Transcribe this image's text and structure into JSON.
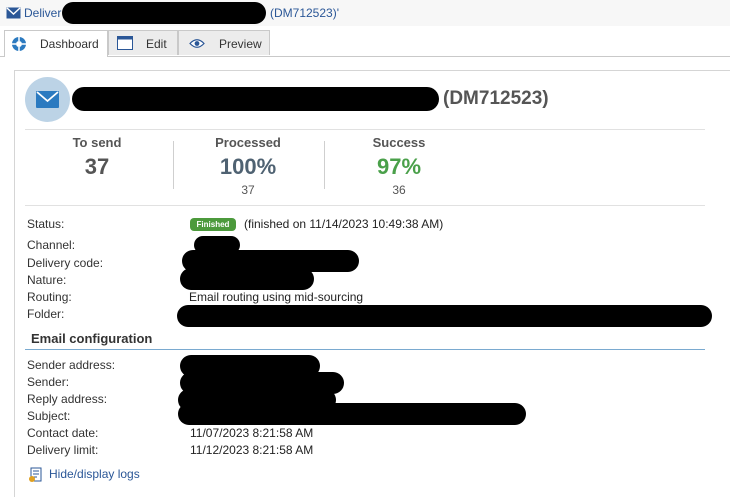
{
  "titlebar": {
    "prefix": "Deliver",
    "suffix": "(DM712523)'"
  },
  "tabs": [
    {
      "label": "Dashboard",
      "active": true
    },
    {
      "label": "Edit",
      "active": false
    },
    {
      "label": "Preview",
      "active": false
    }
  ],
  "header": {
    "code": "(DM712523)"
  },
  "stats": {
    "to_send": {
      "label": "To send",
      "value": "37"
    },
    "processed": {
      "label": "Processed",
      "value": "100%",
      "count": "37"
    },
    "success": {
      "label": "Success",
      "value": "97%",
      "count": "36",
      "color": "#4aa04a"
    }
  },
  "details": {
    "status_label": "Status:",
    "status_badge": "Finished",
    "status_text": "(finished on 11/14/2023 10:49:38 AM)",
    "channel_label": "Channel:",
    "delivery_code_label": "Delivery code:",
    "nature_label": "Nature:",
    "routing_label": "Routing:",
    "routing_value": "Email routing using mid-sourcing",
    "folder_label": "Folder:"
  },
  "email_config": {
    "title": "Email configuration",
    "sender_address_label": "Sender address:",
    "sender_label": "Sender:",
    "reply_address_label": "Reply address:",
    "subject_label": "Subject:",
    "contact_date_label": "Contact date:",
    "contact_date_value": "11/07/2023 8:21:58 AM",
    "delivery_limit_label": "Delivery limit:",
    "delivery_limit_value": "11/12/2023 8:21:58 AM"
  },
  "logs_link": "Hide/display logs",
  "colors": {
    "accent": "#2b5797",
    "badge": "#4c9a3c",
    "stat_gray": "#555555"
  }
}
